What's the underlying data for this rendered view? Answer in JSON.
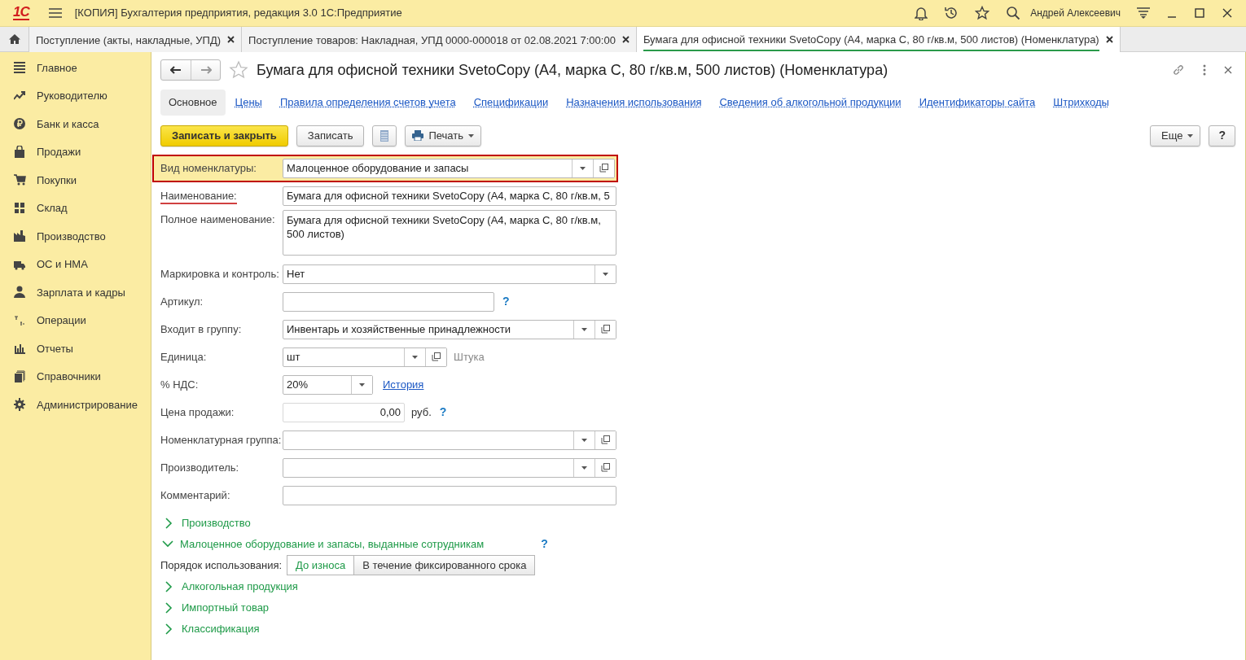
{
  "app": {
    "logo": "1С",
    "title": "[КОПИЯ] Бухгалтерия предприятия, редакция 3.0 1С:Предприятие",
    "user": "Андрей Алексеевич"
  },
  "open_tabs": [
    {
      "label": "Поступление (акты, накладные, УПД)",
      "selected": false
    },
    {
      "label": "Поступление товаров: Накладная, УПД 0000-000018 от 02.08.2021 7:00:00",
      "selected": false
    },
    {
      "label": "Бумага для офисной техники SvetoCopy (А4, марка С, 80 г/кв.м, 500 листов) (Номенклатура)",
      "selected": true
    }
  ],
  "sidebar": {
    "items": [
      {
        "label": "Главное"
      },
      {
        "label": "Руководителю"
      },
      {
        "label": "Банк и касса"
      },
      {
        "label": "Продажи"
      },
      {
        "label": "Покупки"
      },
      {
        "label": "Склад"
      },
      {
        "label": "Производство"
      },
      {
        "label": "ОС и НМА"
      },
      {
        "label": "Зарплата и кадры"
      },
      {
        "label": "Операции"
      },
      {
        "label": "Отчеты"
      },
      {
        "label": "Справочники"
      },
      {
        "label": "Администрирование"
      }
    ]
  },
  "form": {
    "title": "Бумага для офисной техники SvetoCopy (А4, марка С, 80 г/кв.м, 500 листов) (Номенклатура)",
    "tabs": [
      {
        "label": "Основное",
        "selected": true
      },
      {
        "label": "Цены",
        "selected": false
      },
      {
        "label": "Правила определения счетов учета",
        "selected": false
      },
      {
        "label": "Спецификации",
        "selected": false
      },
      {
        "label": "Назначения использования",
        "selected": false
      },
      {
        "label": "Сведения об алкогольной продукции",
        "selected": false
      },
      {
        "label": "Идентификаторы сайта",
        "selected": false
      },
      {
        "label": "Штрихкоды",
        "selected": false
      }
    ],
    "toolbar": {
      "save_close": "Записать и закрыть",
      "save": "Записать",
      "print": "Печать",
      "more": "Еще",
      "help": "?"
    },
    "fields": [
      {
        "kind": "reference",
        "label": "Вид номенклатуры:",
        "value": "Малоценное оборудование и запасы",
        "highlighted": true,
        "required": false
      },
      {
        "kind": "text",
        "label": "Наименование:",
        "value": "Бумага для офисной техники SvetoCopy (А4, марка С, 80 г/кв.м, 5",
        "highlighted": false,
        "required": true
      },
      {
        "kind": "multiline",
        "label": "Полное наименование:",
        "value": "Бумага для офисной техники SvetoCopy (А4, марка С, 80 г/кв.м, 500 листов)",
        "highlighted": false,
        "required": false
      },
      {
        "kind": "choice",
        "label": "Маркировка и контроль:",
        "value": "Нет",
        "highlighted": false,
        "required": false
      },
      {
        "kind": "text",
        "label": "Артикул:",
        "help": "?",
        "highlighted": false,
        "required": false
      },
      {
        "kind": "reference",
        "label": "Входит в группу:",
        "value": "Инвентарь и хозяйственные принадлежности",
        "highlighted": false,
        "required": false
      },
      {
        "kind": "reference",
        "label": "Единица:",
        "value": "шт",
        "note": "Штука",
        "highlighted": false,
        "required": false
      },
      {
        "kind": "choice",
        "label": "% НДС:",
        "value": "20%",
        "link": "История",
        "highlighted": false,
        "required": false
      },
      {
        "kind": "number",
        "label": "Цена продажи:",
        "value": "0,00",
        "unit": "руб.",
        "help": "?",
        "highlighted": false,
        "required": false
      },
      {
        "kind": "reference",
        "label": "Номенклатурная группа:",
        "highlighted": false,
        "required": false
      },
      {
        "kind": "reference",
        "label": "Производитель:",
        "highlighted": false,
        "required": false
      },
      {
        "kind": "text",
        "label": "Комментарий:",
        "highlighted": false,
        "required": false
      }
    ],
    "sections": [
      {
        "label": "Производство",
        "expanded": false
      },
      {
        "label": "Малоценное оборудование и запасы, выданные сотрудникам",
        "expanded": true,
        "help": "?",
        "usage": {
          "label": "Порядок использования:",
          "options": [
            {
              "label": "До износа",
              "selected": true
            },
            {
              "label": "В течение фиксированного срока",
              "selected": false
            }
          ]
        }
      },
      {
        "label": "Алкогольная продукция",
        "expanded": false
      },
      {
        "label": "Импортный товар",
        "expanded": false
      },
      {
        "label": "Классификация",
        "expanded": false
      }
    ]
  }
}
